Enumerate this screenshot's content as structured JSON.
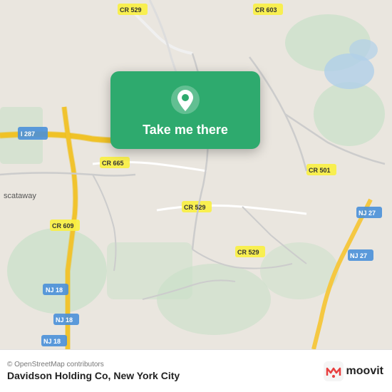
{
  "map": {
    "background_color": "#e8e0d8",
    "alt": "Map of Davidson Holding Co area, New Jersey"
  },
  "popup": {
    "label": "Take me there",
    "pin_alt": "location-pin"
  },
  "bottom_bar": {
    "credit": "© OpenStreetMap contributors",
    "location": "Davidson Holding Co, New York City",
    "logo_text": "moovit"
  }
}
